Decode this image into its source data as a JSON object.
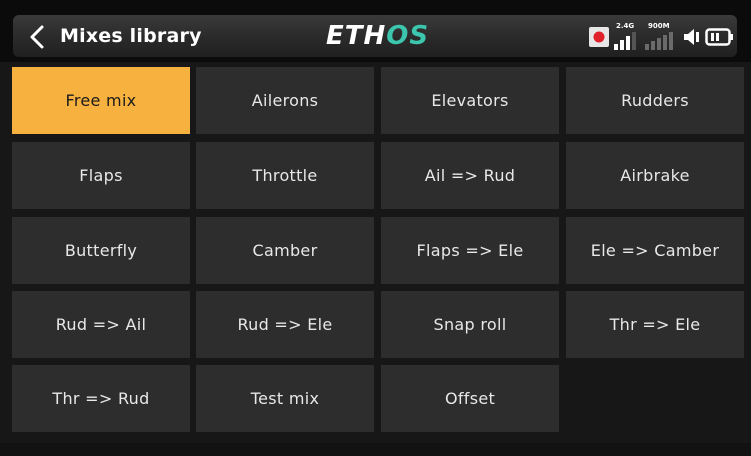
{
  "header": {
    "title": "Mixes library",
    "brand_part1": "ETH",
    "brand_part2": "OS",
    "brand_accent_color": "#3cc6ad"
  },
  "status": {
    "rf_label": "2.4G",
    "telemetry_label": "900M",
    "icons": [
      "record-icon",
      "rf-signal-icon",
      "telemetry-signal-icon",
      "volume-icon",
      "battery-icon"
    ]
  },
  "colors": {
    "selected_tile": "#f6b13e",
    "tile": "#2d2d2d",
    "record": "#e0202a"
  },
  "mixes": [
    {
      "label": "Free mix",
      "selected": true
    },
    {
      "label": "Ailerons"
    },
    {
      "label": "Elevators"
    },
    {
      "label": "Rudders"
    },
    {
      "label": "Flaps"
    },
    {
      "label": "Throttle"
    },
    {
      "label": "Ail => Rud"
    },
    {
      "label": "Airbrake"
    },
    {
      "label": "Butterfly"
    },
    {
      "label": "Camber"
    },
    {
      "label": "Flaps => Ele"
    },
    {
      "label": "Ele => Camber"
    },
    {
      "label": "Rud => Ail"
    },
    {
      "label": "Rud => Ele"
    },
    {
      "label": "Snap roll"
    },
    {
      "label": "Thr => Ele"
    },
    {
      "label": "Thr => Rud"
    },
    {
      "label": "Test mix"
    },
    {
      "label": "Offset"
    }
  ]
}
